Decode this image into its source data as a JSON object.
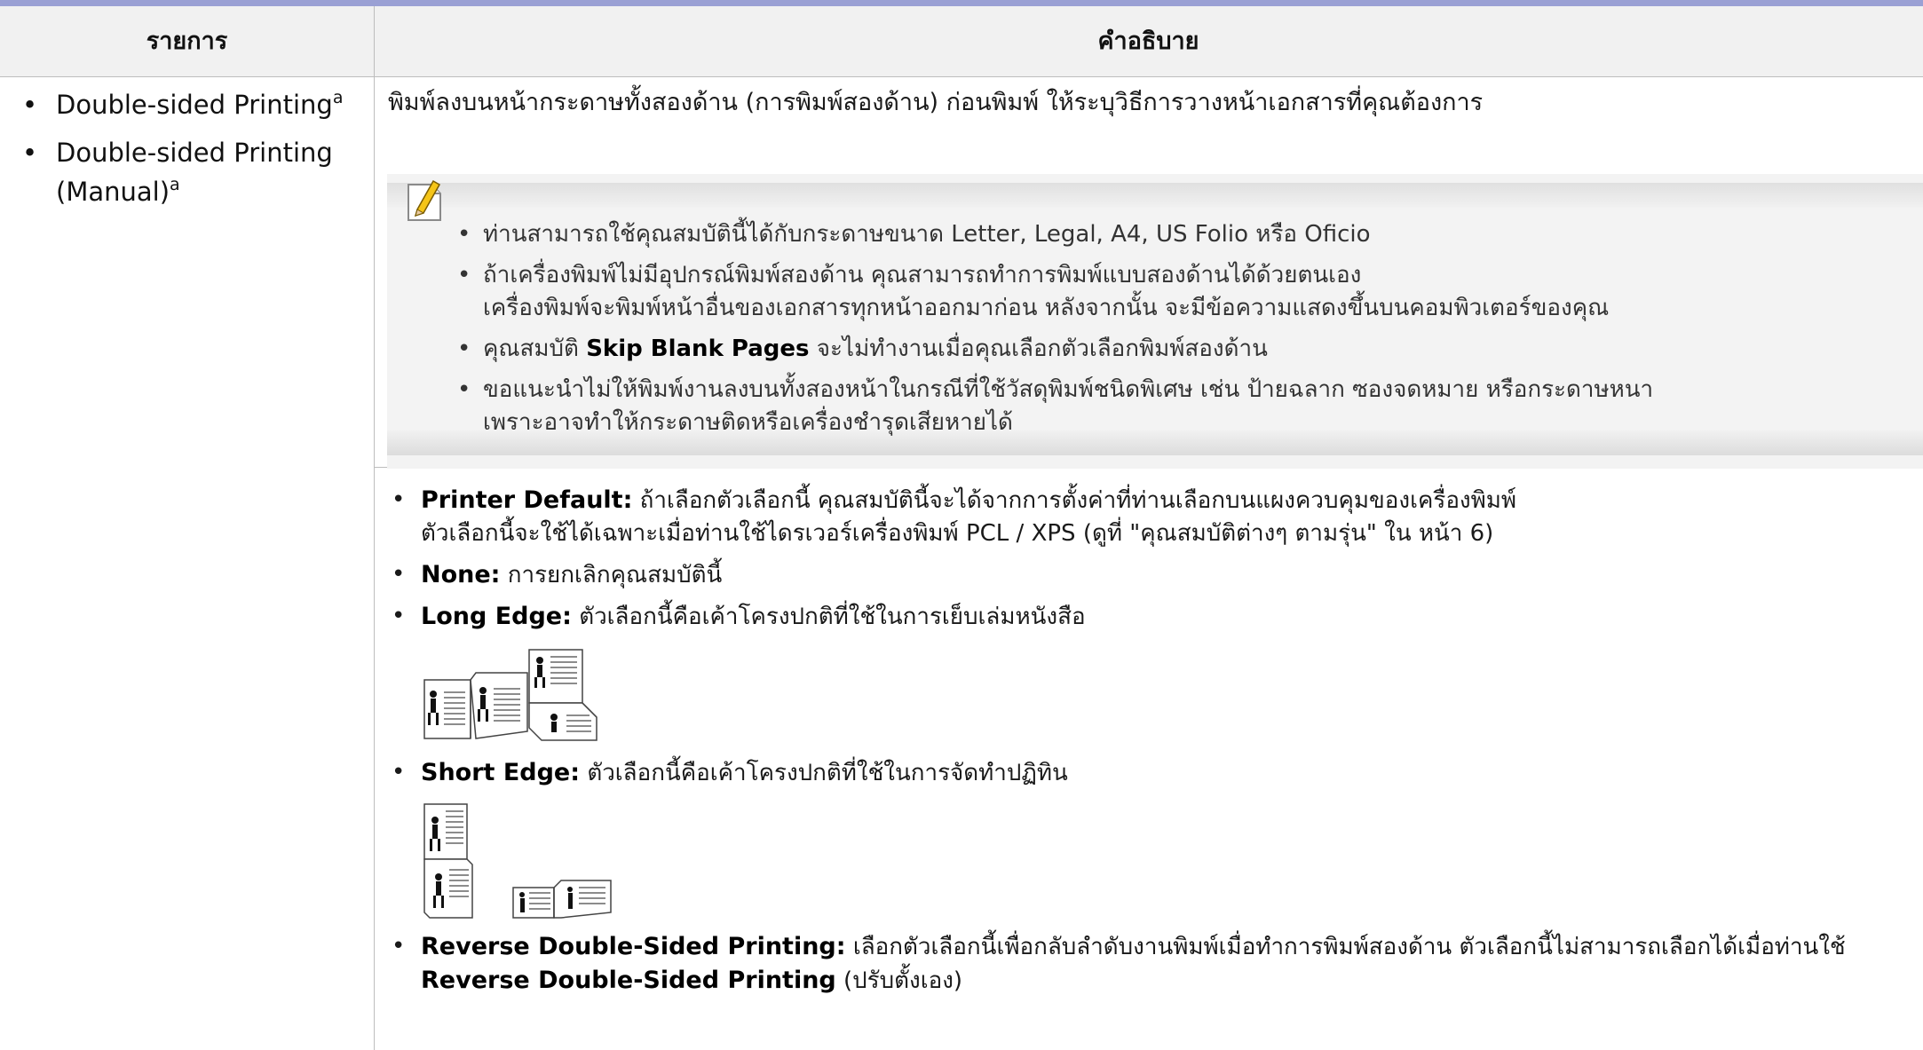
{
  "table": {
    "header": {
      "col1": "รายการ",
      "col2": "คำอธิบาย"
    },
    "items": [
      {
        "label": "Double-sided Printing",
        "sup": "a"
      },
      {
        "label_line1": "Double-sided Printing",
        "label_line2": "(Manual)",
        "sup": "a"
      }
    ],
    "lead": "พิมพ์ลงบนหน้ากระดาษทั้งสองด้าน (การพิมพ์สองด้าน) ก่อนพิมพ์ ให้ระบุวิธีการวางหน้าเอกสารที่คุณต้องการ",
    "note": {
      "icon": "note-pencil-icon",
      "items": [
        {
          "text": "ท่านสามารถใช้คุณสมบัตินี้ได้กับกระดาษขนาด Letter, Legal, A4, US Folio หรือ Oficio"
        },
        {
          "line1": "ถ้าเครื่องพิมพ์ไม่มีอุปกรณ์พิมพ์สองด้าน คุณสามารถทำการพิมพ์แบบสองด้านได้ด้วยตนเอง",
          "line2": "เครื่องพิมพ์จะพิมพ์หน้าอื่นของเอกสารทุกหน้าออกมาก่อน หลังจากนั้น จะมีข้อความแสดงขึ้นบนคอมพิวเตอร์ของคุณ"
        },
        {
          "pre": "คุณสมบัติ",
          "bold": "Skip Blank Pages",
          "post": "จะไม่ทำงานเมื่อคุณเลือกตัวเลือกพิมพ์สองด้าน"
        },
        {
          "line1": "ขอแนะนำไม่ให้พิมพ์งานลงบนทั้งสองหน้าในกรณีที่ใช้วัสดุพิมพ์ชนิดพิเศษ เช่น ป้ายฉลาก ซองจดหมาย หรือกระดาษหนา",
          "line2": "เพราะอาจทำให้กระดาษติดหรือเครื่องชำรุดเสียหายได้"
        }
      ]
    },
    "options": {
      "printer_default": {
        "name": "Printer Default:",
        "line1": "ถ้าเลือกตัวเลือกนี้ คุณสมบัตินี้จะได้จากการตั้งค่าที่ท่านเลือกบนแผงควบคุมของเครื่องพิมพ์",
        "line2": "ตัวเลือกนี้จะใช้ได้เฉพาะเมื่อท่านใช้ไดรเวอร์เครื่องพิมพ์ PCL / XPS (ดูที่ \"คุณสมบัติต่างๆ ตามรุ่น\"  ใน หน้า 6)"
      },
      "none": {
        "name": "None:",
        "text": "การยกเลิกคุณสมบัตินี้"
      },
      "long_edge": {
        "name": "Long Edge:",
        "text": "ตัวเลือกนี้คือเค้าโครงปกติที่ใช้ในการเย็บเล่มหนังสือ"
      },
      "short_edge": {
        "name": "Short Edge:",
        "text": "ตัวเลือกนี้คือเค้าโครงปกติที่ใช้ในการจัดทำปฏิทิน"
      },
      "reverse": {
        "name": "Reverse Double-Sided Printing:",
        "line1": "เลือกตัวเลือกนี้เพื่อกลับลำดับงานพิมพ์เมื่อทำการพิมพ์สองด้าน ตัวเลือกนี้ไม่สามารถเลือกได้เมื่อท่านใช้",
        "line2_bold": "Reverse Double-Sided Printing",
        "line2_post": "(ปรับตั้งเอง)"
      }
    },
    "bullet": "•"
  }
}
